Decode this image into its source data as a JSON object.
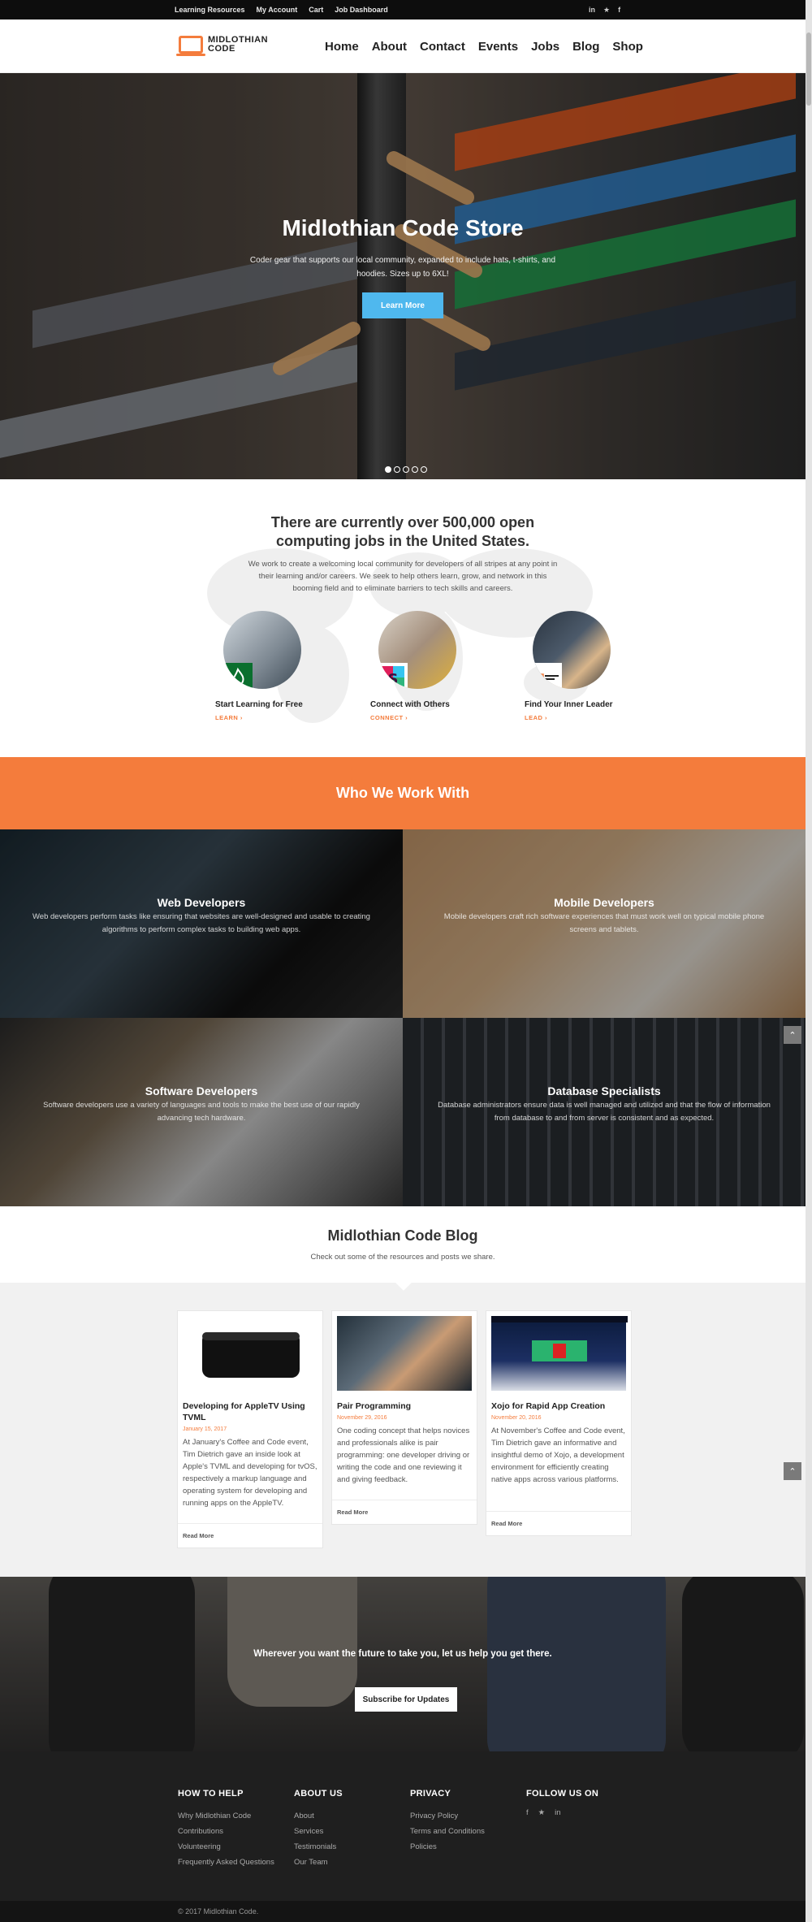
{
  "topbar": {
    "links": [
      "Learning Resources",
      "My Account",
      "Cart",
      "Job Dashboard"
    ],
    "social_icons": [
      "linkedin-icon",
      "twitter-icon",
      "facebook-icon"
    ],
    "social_glyphs": [
      "in",
      "★",
      "f"
    ]
  },
  "header": {
    "logo_line1": "MIDLOTHIAN",
    "logo_line2": "CODE",
    "nav": [
      "Home",
      "About",
      "Contact",
      "Events",
      "Jobs",
      "Blog",
      "Shop"
    ]
  },
  "hero": {
    "title": "Midlothian Code Store",
    "text": "Coder gear that supports our local community, expanded to include hats, t-shirts, and hoodies. Sizes up to 6XL!",
    "button": "Learn More",
    "slides": 5,
    "active_slide": 1
  },
  "jobs": {
    "heading": "There are currently over 500,000 open computing jobs in the United States.",
    "text": "We work to create a welcoming local community for developers of all stripes at any point in their learning and/or careers. We seek to help others learn, grow, and network in this booming field and to eliminate barriers to tech skills and careers.",
    "features": [
      {
        "title": "Start Learning for Free",
        "cta": "LEARN ›"
      },
      {
        "title": "Connect with Others",
        "cta": "CONNECT ›"
      },
      {
        "title": "Find Your Inner Leader",
        "cta": "LEAD ›"
      }
    ]
  },
  "audience": {
    "heading": "Who We Work With",
    "tiles": [
      {
        "title": "Web Developers",
        "text": "Web developers perform tasks like ensuring that websites are well-designed and usable to creating algorithms to perform complex tasks to building web apps."
      },
      {
        "title": "Mobile Developers",
        "text": "Mobile developers craft rich software experiences that must work well on typical mobile phone screens and tablets."
      },
      {
        "title": "Software Developers",
        "text": "Software developers use a variety of languages and tools to make the best use of our rapidly advancing tech hardware."
      },
      {
        "title": "Database Specialists",
        "text": "Database administrators ensure data is well managed and utilized and that the flow of information from database to and from server is consistent and as expected."
      }
    ]
  },
  "blog": {
    "heading": "Midlothian Code Blog",
    "subheading": "Check out some of the resources and posts we share.",
    "read_more": "Read More",
    "posts": [
      {
        "title": "Developing for AppleTV Using TVML",
        "date": "January 15, 2017",
        "excerpt": "At January's Coffee and Code event, Tim Dietrich gave an inside look at Apple's TVML and developing for tvOS, respectively a markup language and operating system for developing and running apps on the AppleTV."
      },
      {
        "title": "Pair Programming",
        "date": "November 29, 2016",
        "excerpt": "One coding concept that helps novices and professionals alike is pair programming: one developer driving or writing the code and one reviewing it and giving feedback."
      },
      {
        "title": "Xojo for Rapid App Creation",
        "date": "November 20, 2016",
        "excerpt": "At November's Coffee and Code event, Tim Dietrich gave an informative and insightful demo of Xojo, a development environment for efficiently creating native apps across various platforms."
      }
    ]
  },
  "subscribe": {
    "text": "Wherever you want the future to take you, let us help you get there.",
    "button": "Subscribe for Updates"
  },
  "footer": {
    "columns": [
      {
        "title": "HOW TO HELP",
        "items": [
          "Why Midlothian Code",
          "Contributions",
          "Volunteering",
          "Frequently Asked Questions"
        ]
      },
      {
        "title": "ABOUT US",
        "items": [
          "About",
          "Services",
          "Testimonials",
          "Our Team"
        ]
      },
      {
        "title": "PRIVACY",
        "items": [
          "Privacy Policy",
          "Terms and Conditions",
          "Policies"
        ]
      }
    ],
    "follow_title": "FOLLOW US ON",
    "follow_icons": [
      "facebook-icon",
      "twitter-icon",
      "linkedin-icon"
    ],
    "follow_glyphs": [
      "f",
      "★",
      "in"
    ],
    "copyright": "© 2017 Midlothian Code."
  },
  "colors": {
    "accent": "#f47c3c",
    "button_blue": "#4fb8ee",
    "footer_bg": "#1f1f1f"
  }
}
